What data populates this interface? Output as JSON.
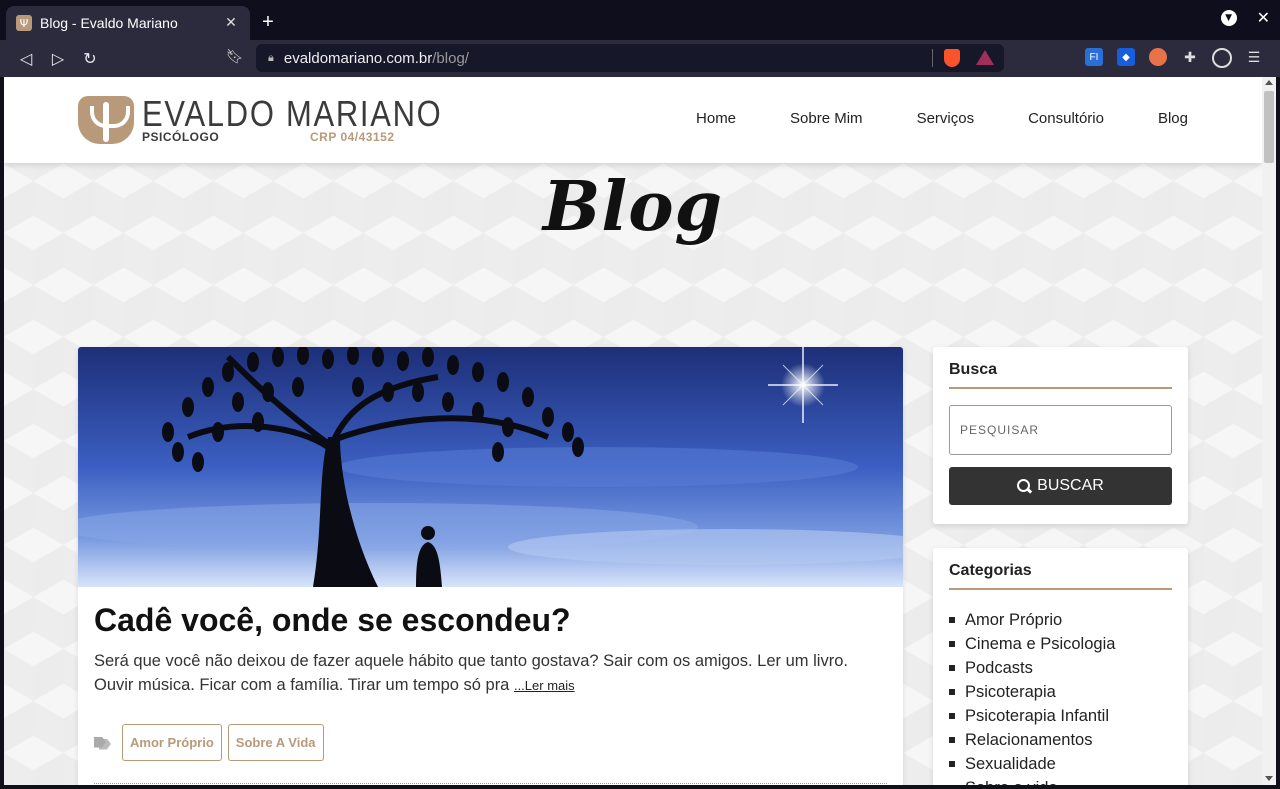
{
  "browser": {
    "tab_title": "Blog - Evaldo Mariano",
    "url_domain": "evaldomariano.com.br",
    "url_path": "/blog/",
    "new_tab_label": "+",
    "tab_close_label": "✕",
    "window_close_label": "✕"
  },
  "site": {
    "logo_name": "EVALDO MARIANO",
    "logo_sub": "PSICÓLOGO",
    "logo_crp": "CRP 04/43152",
    "brand_color": "#b89a7a",
    "menu": [
      "Home",
      "Sobre Mim",
      "Serviços",
      "Consultório",
      "Blog"
    ]
  },
  "hero": {
    "title": "Blog"
  },
  "post": {
    "title": "Cadê você, onde se escondeu?",
    "excerpt": "Será que você não deixou de fazer aquele hábito que tanto gostava? Sair com os amigos. Ler um livro. Ouvir música. Ficar com a família. Tirar um tempo só pra ",
    "read_more": "...Ler mais",
    "tags": [
      "Amor Próprio",
      "Sobre A Vida"
    ]
  },
  "sidebar": {
    "search_title": "Busca",
    "search_placeholder": "PESQUISAR",
    "search_button": "BUSCAR",
    "categories_title": "Categorias",
    "categories": [
      "Amor Próprio",
      "Cinema e Psicologia",
      "Podcasts",
      "Psicoterapia",
      "Psicoterapia Infantil",
      "Relacionamentos",
      "Sexualidade",
      "Sobre a vida"
    ]
  }
}
